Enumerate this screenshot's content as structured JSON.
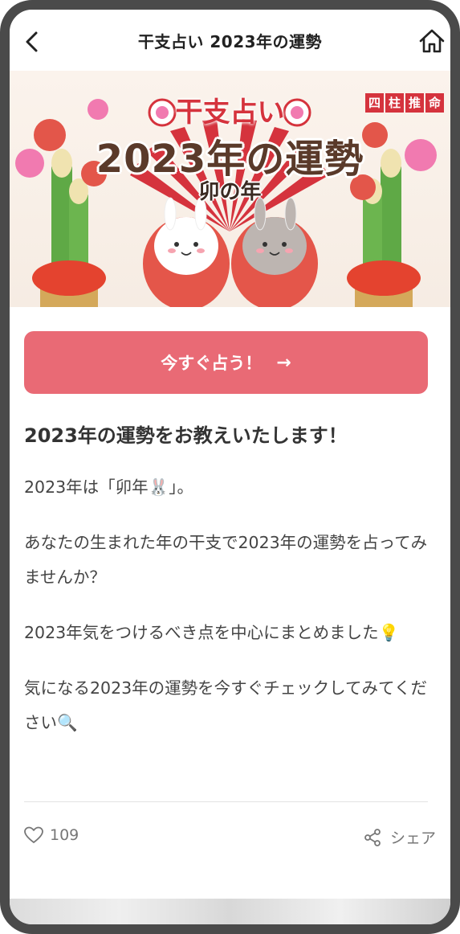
{
  "header": {
    "title": "干支占い 2023年の運勢",
    "back_icon": "chevron-left-icon",
    "home_icon": "home-icon"
  },
  "banner": {
    "badge": [
      "四",
      "柱",
      "推",
      "命"
    ],
    "title_top": "干支占い",
    "title_main": "2023年の運勢",
    "title_sub": "卯の年"
  },
  "cta": {
    "label": "今すぐ占う！",
    "arrow": "→",
    "color": "#e96a75"
  },
  "article": {
    "heading": "2023年の運勢をお教えいたします！",
    "paragraphs": [
      "2023年は「卯年🐰」。",
      "あなたの生まれた年の干支で2023年の運勢を占ってみませんか？",
      "2023年気をつけるべき点を中心にまとめました💡",
      "気になる2023年の運勢を今すぐチェックしてみてください🔍"
    ]
  },
  "footer": {
    "like_count": "109",
    "share_label": "シェア"
  }
}
